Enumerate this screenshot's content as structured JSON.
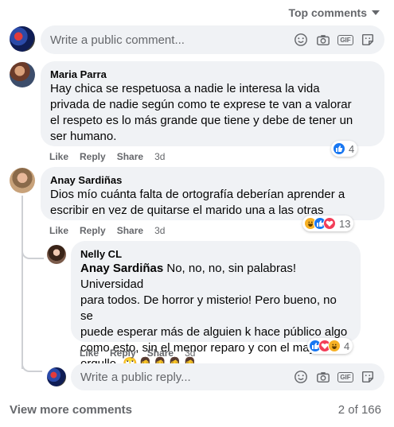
{
  "sort": {
    "label": "Top comments"
  },
  "composer_top": {
    "placeholder": "Write a public comment..."
  },
  "composer_reply": {
    "placeholder": "Write a public reply..."
  },
  "toolbar": {
    "gif_label": "GIF"
  },
  "comments": [
    {
      "author": "Maria Parra",
      "lines": [
        "Hay chica se respetuosa a nadie le interesa la vida",
        "privada de nadie según como te exprese te van a valorar",
        "el respeto es lo más grande que tiene y debe de tener un",
        "ser humano."
      ],
      "actions": {
        "like": "Like",
        "reply": "Reply",
        "share": "Share",
        "time": "3d"
      },
      "reactions": {
        "icons": [
          "like-icon"
        ],
        "count": "4"
      }
    },
    {
      "author": "Anay Sardiñas",
      "lines": [
        "Dios mío cuánta falta de ortografía deberían aprender a",
        "escribir en vez de quitarse el marido una a las otras"
      ],
      "actions": {
        "like": "Like",
        "reply": "Reply",
        "share": "Share",
        "time": "3d"
      },
      "reactions": {
        "icons": [
          "haha-icon",
          "like-icon",
          "love-icon"
        ],
        "count": "13"
      }
    }
  ],
  "reply": {
    "author": "Nelly CL",
    "mention": "Anay Sardiñas",
    "first_line_rest": " No, no, no, sin palabras! Universidad",
    "lines": [
      "para todos. De horror y misterio! Pero bueno, no se",
      "puede esperar más de alguien k hace público algo",
      "como esto, sin el menor reparo y con el mayor",
      "orgullo. 🙄🤦‍♀️🤦‍♀️🤦‍♀️🤦‍♀️"
    ],
    "actions": {
      "like": "Like",
      "reply": "Reply",
      "share": "Share",
      "time": "3d"
    },
    "reactions": {
      "icons": [
        "like-icon",
        "love-icon",
        "haha-icon"
      ],
      "count": "4"
    }
  },
  "footer": {
    "view_more": "View more comments",
    "pagination": "2 of 166"
  },
  "colors": {
    "bubble": "#f0f2f5",
    "secondary_text": "#65676b",
    "like": "#1877f2",
    "love": "#f33e58",
    "haha": "#f7b125"
  }
}
